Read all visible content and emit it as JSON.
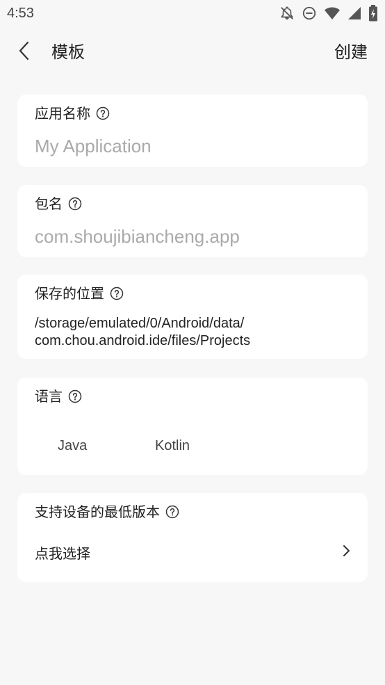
{
  "status_bar": {
    "time": "4:53",
    "icons": [
      "notifications-off-icon",
      "do-not-disturb-icon",
      "wifi-icon",
      "signal-icon",
      "battery-icon"
    ]
  },
  "app_bar": {
    "back_icon": "chevron-left-icon",
    "title": "模板",
    "action_label": "创建"
  },
  "app_name": {
    "label": "应用名称",
    "placeholder": "My Application",
    "value": ""
  },
  "package_name": {
    "label": "包名",
    "placeholder": "com.shoujibiancheng.app",
    "value": ""
  },
  "save_location": {
    "label": "保存的位置",
    "path": "/storage/emulated/0/Android/data/\ncom.chou.android.ide/files/Projects"
  },
  "language": {
    "label": "语言",
    "options": [
      "Java",
      "Kotlin"
    ]
  },
  "min_version": {
    "label": "支持设备的最低版本",
    "select_text": "点我选择"
  }
}
